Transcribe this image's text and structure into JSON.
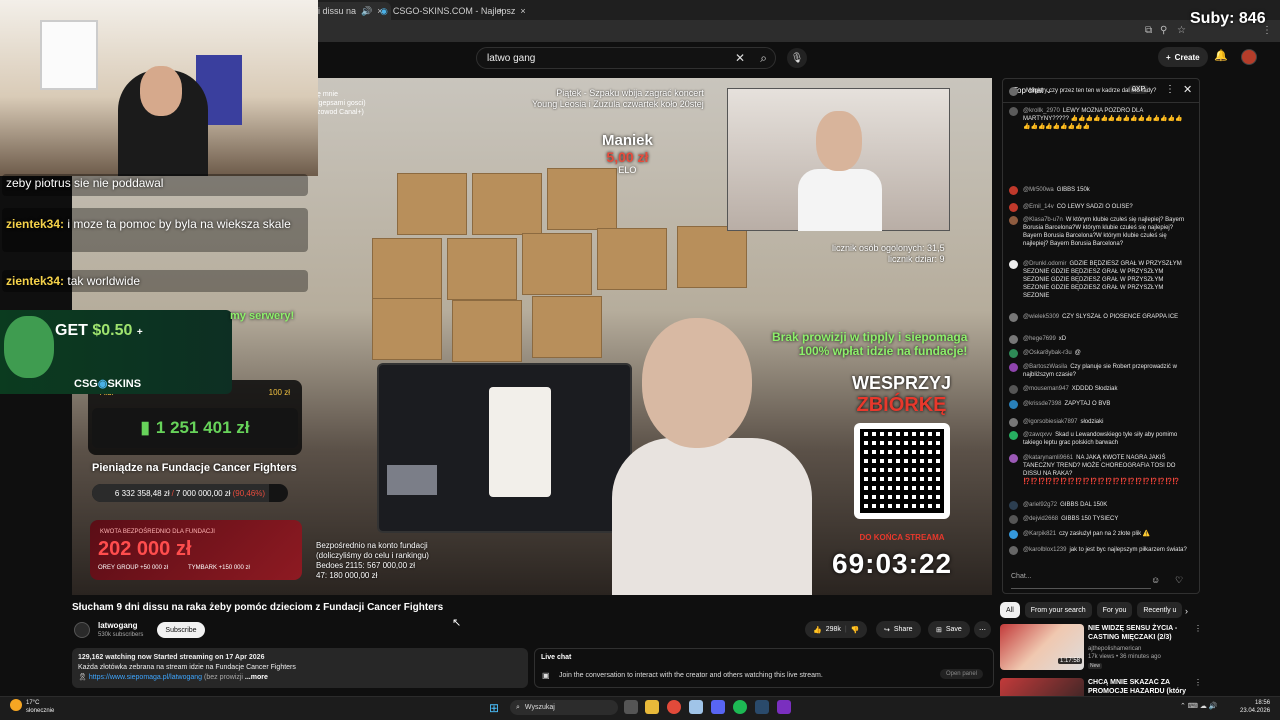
{
  "browser": {
    "tab1_label": "i dissu na",
    "tab2_label": "CSGO-SKINS.COM - Najlepsz",
    "new_tab": "+"
  },
  "overlay": {
    "subs_counter": "Suby: 846"
  },
  "header": {
    "search_value": "latwo gang",
    "create_label": "Create"
  },
  "stream_chat_overlay": [
    {
      "name": "",
      "text": "zeby piotrus sie nie poddawal"
    },
    {
      "name": "zientek34:",
      "text": "i moze ta pomoc by byla na wieksza skale"
    },
    {
      "name": "zientek34:",
      "text": "tak worldwide"
    }
  ],
  "promo": {
    "get": "GET",
    "amount": "$0.50",
    "plus": "+",
    "brand": "CSG",
    "brand2": "SKINS",
    "side_text": "my serwery!"
  },
  "video": {
    "top_left_lines": [
      "ę mnie",
      "lgepsami gosci)",
      "zowod Canal+)"
    ],
    "top_center_lines": [
      "Piątek - Szpaku wbija zagrać koncert",
      "Young Leosia i Zuzula czwartek koło 20stej"
    ],
    "donor": {
      "name": "Maniek",
      "amount": "5,00 zł",
      "message": "ELO"
    },
    "counter_lines": [
      "licznik osób ogolonych: 31,5",
      "licznik dziar: 9"
    ],
    "brak_lines": [
      "Brak prowizji w tipply i siepomaga",
      "100% wpłat idzie na fundacje!"
    ],
    "wesprzyj": "WESPRZYJ",
    "zbiorke": "ZBIÓRKĘ",
    "do_konca": "DO KOŃCA STREAMA",
    "timer": "69:03:22",
    "bezposr_lines": [
      "Bezpośrednio na konto fundacji",
      "(doliczyliśmy do celu i rankingu)",
      "Bedoes 2115: 567 000,00 zł",
      "47: 180 000,00 zł"
    ]
  },
  "donations": {
    "row_left": "Aldi",
    "row_right": "100 zł",
    "total": "1 251 401 zł",
    "fund_title": "Pieniądze na Fundacje Cancer Fighters",
    "progress_current": "6 332 358,48 zł",
    "progress_slash": "/",
    "progress_goal": "7 000 000,00 zł",
    "progress_pct": "(90,46%)",
    "progress_fraction": 0.9046,
    "kwota_label": "KWOTA BEZPOŚREDNIO DLA FUNDACJI",
    "kwota_value": "202 000 zł",
    "kwota_left": "OREY GROUP +50 000 zł",
    "kwota_right": "TYMBARK +150 000 zł"
  },
  "video_info": {
    "title": "Słucham 9 dni dissu na raka żeby pomóc dzieciom z Fundacji Cancer Fighters",
    "channel": "latwogang",
    "subscribers": "530k subscribers",
    "subscribe": "Subscribe",
    "likes": "298k",
    "share": "Share",
    "save": "Save",
    "desc_line1": "129,162 watching now  Started streaming on 17 Apr 2026",
    "desc_line2": "Każda złotówka zebrana na stream idzie na Fundacje Cancer Fighters",
    "desc_link": "https://www.siepomaga.pl/latwogang",
    "desc_after": "(bez prowizji",
    "desc_more": "...more"
  },
  "live_chat_card": {
    "title": "Live chat",
    "text": "Join the conversation to interact with the creator and others watching this live stream.",
    "open_panel": "Open panel"
  },
  "chat": {
    "sort_label": "Top chat",
    "xp_label": "0XP",
    "input_placeholder": "Chat...",
    "messages": [
      {
        "user": "",
        "text": "Magiery czy przez ten ten w kadrze dal mu rady?",
        "color": "#6b6b6b"
      },
      {
        "user": "@krollk_2970",
        "text": "LEWY MOZNA POZDRO DLA MARTYNY????? 👍👍👍👍👍👍👍👍👍👍👍👍👍👍👍👍👍👍👍👍👍👍👍👍",
        "color": "#5a5a5a"
      },
      {
        "user": "@Mr500wa",
        "text": "GIBBS 150k",
        "color": "#c0392b"
      },
      {
        "user": "@Emil_14v",
        "text": "CO LEWY SADZI O OLISE?",
        "color": "#c0392b"
      },
      {
        "user": "@Klasa7b-u7n",
        "text": "W którym klubie czułeś się najlepiej? Bayern Borusia Barcelona?W którym klubie czułeś się najlepiej? Bayern Borusia Barcelona?W którym klubie czułeś się najlepiej? Bayern Borusia Barcelona?",
        "color": "#8e5b3f"
      },
      {
        "user": "@Drunkl.odomir",
        "text": "GDZIE BĘDZIESZ GRAŁ W PRZYSZŁYM SEZONIE GDZIE BĘDZIESZ GRAŁ W PRZYSZŁYM SEZONIE GDZIE BĘDZIESZ GRAŁ W PRZYSZŁYM SEZONIE GDZIE BĘDZIESZ GRAŁ W PRZYSZŁYM SEZONIE",
        "color": "#eeeeee"
      },
      {
        "user": "@wielek5309",
        "text": "CZY SLYSZAŁ O PIOSENCE GRAPPA ICE",
        "color": "#777777"
      },
      {
        "user": "@hege7699",
        "text": "xD",
        "color": "#777777"
      },
      {
        "user": "@Oskar8ybak-r3u",
        "text": "@",
        "color": "#2e8b57"
      },
      {
        "user": "@BartoszWasila",
        "text": "Czy planuje sie Robert przeprowadzić w najbliższym czasie?",
        "color": "#8e44ad"
      },
      {
        "user": "@mouseman947",
        "text": "XDDDD Słodziak",
        "color": "#555555"
      },
      {
        "user": "@krissde7398",
        "text": "ZAPYTAJ O BVB",
        "color": "#2980b9"
      },
      {
        "user": "@igorsobiesiak7897",
        "text": "słodziaki",
        "color": "#777777"
      },
      {
        "user": "@zawqxvv",
        "text": "Skad u Lewandowskiego tyle siły aby pomimo takiego łeptu grac polskich barwach",
        "color": "#27ae60"
      },
      {
        "user": "@katarynamli9661",
        "text": "NA JAKĄ KWOTE NAGRA JAKIŚ TANECZNY TREND? MOŻE CHOREOGRAFIA TOSI DO DISSU NA RAKA? ⁉️⁉️⁉️⁉️⁉️⁉️⁉️⁉️⁉️⁉️⁉️⁉️⁉️⁉️⁉️⁉️⁉️⁉️⁉️⁉️⁉️",
        "color": "#9b59b6"
      },
      {
        "user": "@ariel92g72",
        "text": "GIBBS DAL 150K",
        "color": "#2c3e50"
      },
      {
        "user": "@dejvid2668",
        "text": "GIBBS 150 TYSIECY",
        "color": "#555555"
      },
      {
        "user": "@Karpik821",
        "text": "czy zasłużył pan na 2 złote plik ⚠️",
        "color": "#3498db"
      },
      {
        "user": "@karolblox1239",
        "text": "jak to jest byc najlepszym piłkarzem świata?",
        "color": "#666666"
      }
    ]
  },
  "recommendations": {
    "chips": [
      "All",
      "From your search",
      "For you",
      "Recently u"
    ],
    "items": [
      {
        "title": "NIE WIDZĘ SENSU ŻYCIA - CASTING MIĘCZAKI (2/3)",
        "channel": "ajthepolishamerican",
        "meta": "17k views • 36 minutes ago",
        "badge": "New",
        "duration": "1:17:58"
      },
      {
        "title": "CHCĄ MNIE SKAZAĆ ZA PROMOCJE HAZARDU (który ...",
        "channel": "",
        "meta": "",
        "badge": "",
        "duration": ""
      }
    ]
  },
  "taskbar": {
    "temp": "17°C",
    "weather": "słonecznie",
    "search": "Wyszukaj",
    "time": "18:56",
    "date": "23.04.2026"
  }
}
